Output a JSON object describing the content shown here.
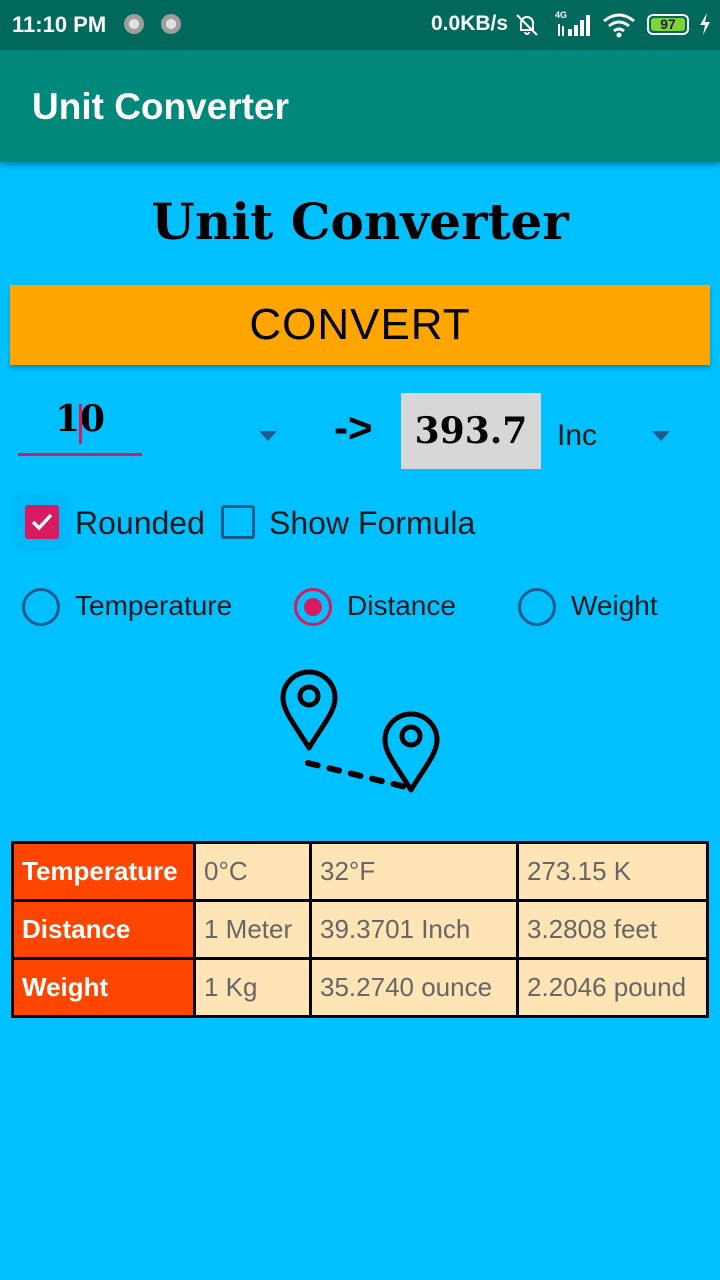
{
  "status_bar": {
    "time": "11:10 PM",
    "network_speed": "0.0KB/s",
    "signal_label": "4G",
    "battery": "97"
  },
  "app_bar": {
    "title": "Unit Converter"
  },
  "header": {
    "title": "Unit Converter"
  },
  "convert_button": {
    "label": "CONVERT"
  },
  "input": {
    "value": "10"
  },
  "arrow": "->",
  "result": {
    "value": "393.7"
  },
  "unit_select": {
    "selected": "Inc"
  },
  "options": {
    "rounded": {
      "label": "Rounded",
      "checked": true
    },
    "show_formula": {
      "label": "Show Formula",
      "checked": false
    }
  },
  "categories": [
    {
      "label": "Temperature",
      "selected": false
    },
    {
      "label": "Distance",
      "selected": true
    },
    {
      "label": "Weight",
      "selected": false
    }
  ],
  "table": {
    "rows": [
      {
        "head": "Temperature",
        "cells": [
          "0°C",
          "32°F",
          "273.15 K"
        ]
      },
      {
        "head": "Distance",
        "cells": [
          "1 Meter",
          "39.3701 Inch",
          "3.2808 feet"
        ]
      },
      {
        "head": "Weight",
        "cells": [
          "1 Kg",
          "35.2740 ounce",
          "2.2046 pound"
        ]
      }
    ]
  },
  "icons": {
    "illustration": "distance-pins-icon",
    "status": [
      "mute-icon",
      "signal-icon",
      "wifi-icon",
      "battery-icon",
      "charging-icon"
    ]
  },
  "colors": {
    "background": "#00C0FF",
    "status_bar": "#00695C",
    "app_bar": "#00897B",
    "button": "#FFA500",
    "accent": "#D81B60",
    "table_head": "#FF4500",
    "table_cell": "#FFE4B5"
  }
}
